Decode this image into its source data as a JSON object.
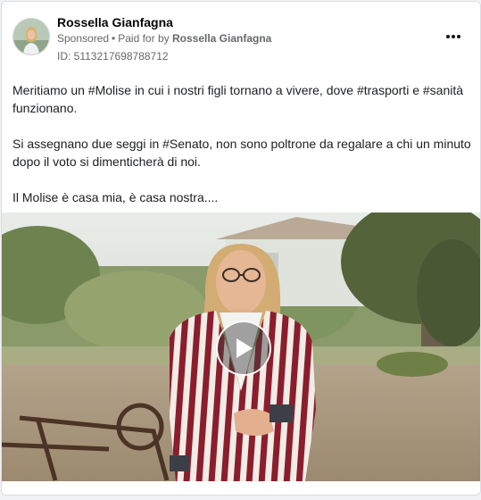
{
  "post": {
    "author_name": "Rossella Gianfagna",
    "sponsored_label": "Sponsored",
    "separator": "•",
    "paid_for_by_label": "Paid for by",
    "paid_for_by_name": "Rossella Gianfagna",
    "ad_id": "ID: 5113217698788712",
    "text_paragraphs": [
      "Meritiamo un #Molise in cui i nostri figli tornano a vivere, dove #trasporti e #sanità funzionano.",
      "Si assegnano due seggi in #Senato, non sono poltrone da regalare a chi un minuto dopo il voto si dimenticherà di noi.",
      "Il Molise è casa mia, è casa nostra...."
    ]
  },
  "icons": {
    "more": "more-options-icon",
    "play": "play-icon"
  },
  "colors": {
    "name": "#050505",
    "meta": "#65676b",
    "jacket_stripe": "#8b1e2c"
  }
}
